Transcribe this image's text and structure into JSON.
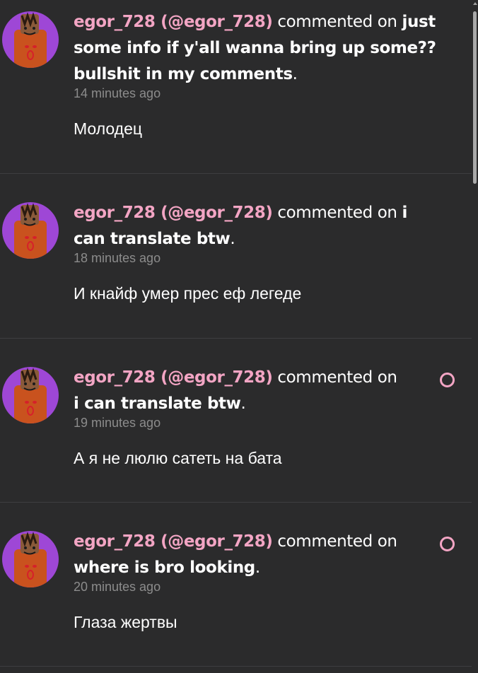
{
  "notifications": [
    {
      "author": "egor_728 (@egor_728)",
      "verb": "commented on",
      "post_title": "just some info if y'all wanna bring up some?? bullshit in my comments",
      "time": "14 minutes ago",
      "comment": "Молодец",
      "unread": false
    },
    {
      "author": "egor_728 (@egor_728)",
      "verb": "commented on",
      "post_title": "i can translate btw",
      "time": "18 minutes ago",
      "comment": "И кнайф умер прес еф легеде",
      "unread": false
    },
    {
      "author": "egor_728 (@egor_728)",
      "verb": "commented on",
      "post_title": "i can translate btw",
      "time": "19 minutes ago",
      "comment": "А я не люлю сатеть на бата",
      "unread": true
    },
    {
      "author": "egor_728 (@egor_728)",
      "verb": "commented on",
      "post_title": "where is bro looking",
      "time": "20 minutes ago",
      "comment": "Глаза жертвы",
      "unread": true
    }
  ],
  "colors": {
    "background": "#2b2b2c",
    "author": "#f3a5c4",
    "avatar_bg": "#9e47d6",
    "divider": "#3e3e40",
    "timestamp": "#8c8c8c"
  },
  "icons": {
    "unread": "unread-circle-icon",
    "scroll_up": "scroll-up-arrow-icon"
  }
}
